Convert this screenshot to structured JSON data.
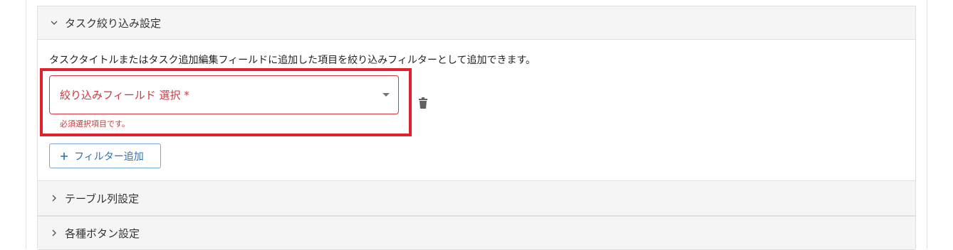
{
  "sections": {
    "task_filter": {
      "title": "タスク絞り込み設定",
      "expanded": true,
      "chevron": "chevron-down-icon",
      "description": "タスクタイトルまたはタスク追加編集フィールドに追加した項目を絞り込みフィルターとして追加できます。",
      "select": {
        "label": "絞り込みフィールド 選択 *",
        "helper_text": "必須選択項目です。",
        "error_color": "#d0353d"
      },
      "delete_icon": "trash-icon",
      "add_button": {
        "icon": "plus-icon",
        "label": "フィルター追加",
        "color": "#2d6db5"
      }
    },
    "table_columns": {
      "title": "テーブル列設定",
      "expanded": false,
      "chevron": "chevron-right-icon"
    },
    "buttons": {
      "title": "各種ボタン設定",
      "expanded": false,
      "chevron": "chevron-right-icon"
    }
  },
  "highlight_color": "#e0202b"
}
